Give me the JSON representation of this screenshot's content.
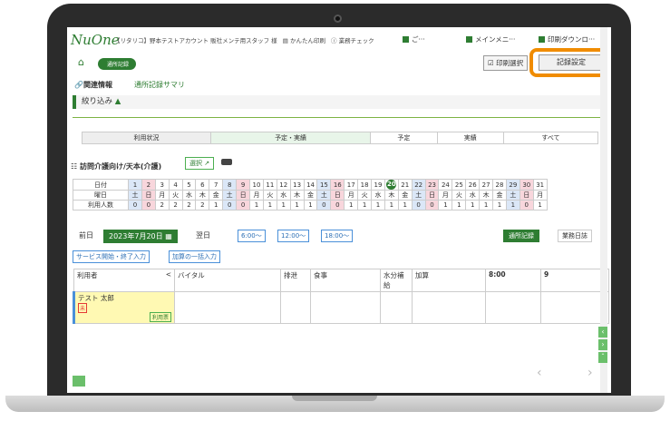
{
  "app": {
    "logo_text": "NuOne",
    "top_info": "【リタリコ】野本テストアカウント 販社メンテ用スタッフ 様",
    "menu_simple_print": "かんたん印刷",
    "menu_business_check": "業務チェック",
    "menu_more": "ご···",
    "menu_main": "メインメニ···",
    "menu_print_download": "印刷ダウンロ···"
  },
  "breadcrumb": {
    "home_icon": "home-icon",
    "pill_label": "通所記録"
  },
  "toolbar": {
    "print_select_label": "印刷選択",
    "record_settings_label": "記録設定"
  },
  "tabs": {
    "related_info": "関連情報",
    "summary": "通所記録サマリ"
  },
  "filter": {
    "title": "絞り込み",
    "columns": [
      "利用状況",
      "予定・実績",
      "予定",
      "実績",
      "すべて"
    ]
  },
  "service": {
    "title": "訪問介護向け/天本(介護)",
    "select_label": "選択"
  },
  "calendar": {
    "row_labels": [
      "日付",
      "曜日",
      "利用人数"
    ],
    "days": [
      "1",
      "2",
      "3",
      "4",
      "5",
      "6",
      "7",
      "8",
      "9",
      "10",
      "11",
      "12",
      "13",
      "14",
      "15",
      "16",
      "17",
      "18",
      "19",
      "20",
      "21",
      "22",
      "23",
      "24",
      "25",
      "26",
      "27",
      "28",
      "29",
      "30",
      "31"
    ],
    "weekdays": [
      "土",
      "日",
      "月",
      "火",
      "水",
      "木",
      "金",
      "土",
      "日",
      "月",
      "火",
      "水",
      "木",
      "金",
      "土",
      "日",
      "月",
      "火",
      "水",
      "木",
      "金",
      "土",
      "日",
      "月",
      "火",
      "水",
      "木",
      "金",
      "土",
      "日",
      "月"
    ],
    "counts": [
      "0",
      "0",
      "2",
      "2",
      "2",
      "2",
      "1",
      "0",
      "0",
      "1",
      "1",
      "1",
      "1",
      "1",
      "0",
      "0",
      "1",
      "1",
      "1",
      "1",
      "1",
      "0",
      "0",
      "1",
      "1",
      "1",
      "1",
      "1",
      "1",
      "0",
      "1"
    ],
    "today": "20"
  },
  "nav": {
    "prev_label": "前日",
    "current_date": "2023年7月20日",
    "next_label": "翌日",
    "times": [
      "6:00〜",
      "12:00〜",
      "18:00〜"
    ],
    "record_tab": "通所記録",
    "daily_tab": "業務日誌"
  },
  "actions": {
    "bulk_start_end": "サービス開始・終了入力",
    "bulk_additions": "加算の一括入力"
  },
  "table": {
    "headers": [
      "利用者",
      "バイタル",
      "排泄",
      "食事",
      "水分補給",
      "加算",
      "8:00",
      "9"
    ],
    "collapse_glyph": "<",
    "user_name": "テスト 太郎",
    "user_badge": "未",
    "user_record_badge": "利用票"
  }
}
